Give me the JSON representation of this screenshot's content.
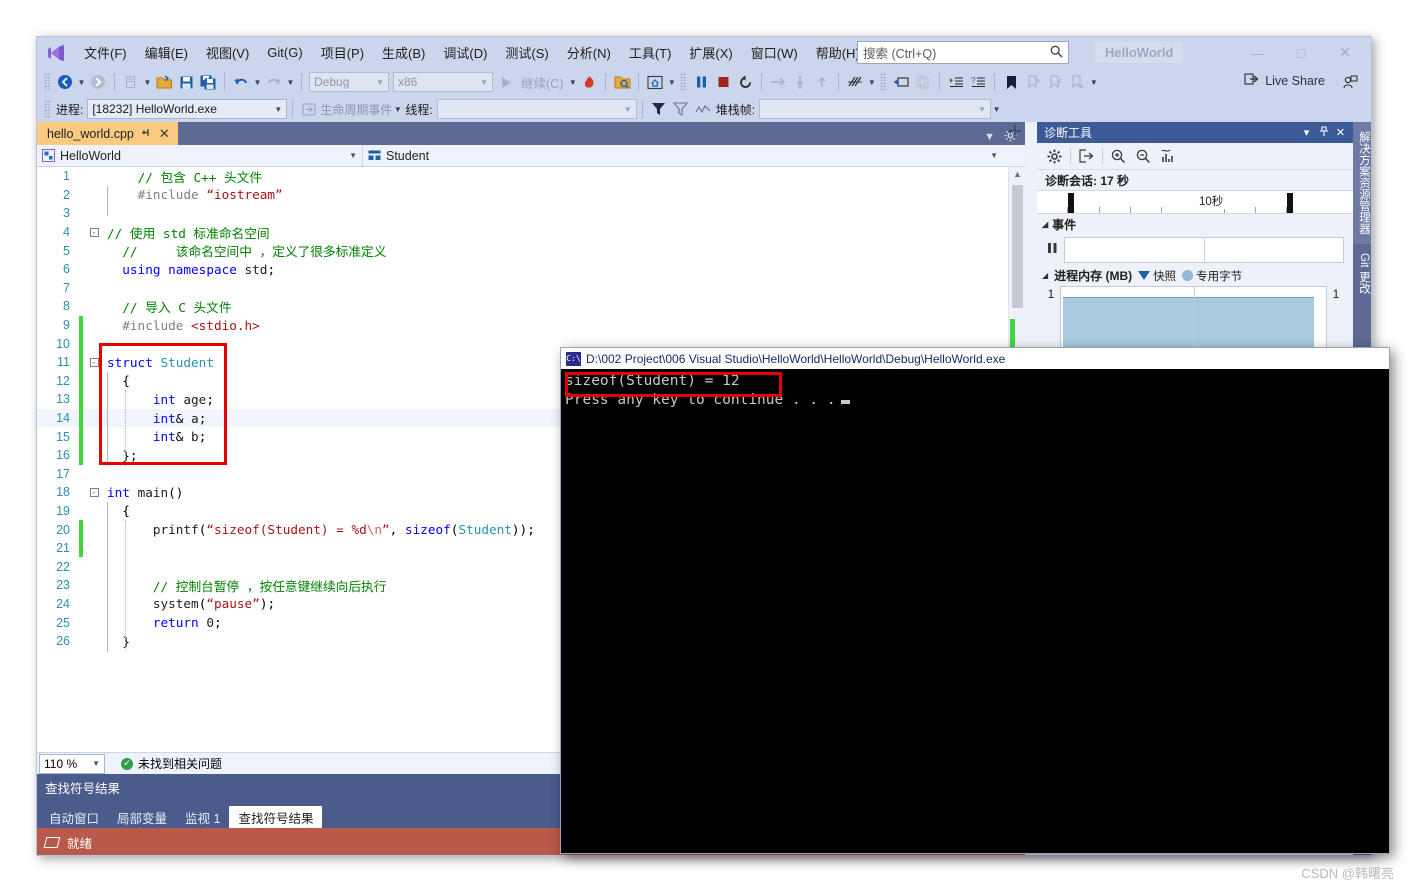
{
  "window": {
    "title": "HelloWorld",
    "minimize": "—",
    "maximize": "□",
    "close": "✕"
  },
  "menubar": {
    "items": [
      {
        "label": "文件(F)"
      },
      {
        "label": "编辑(E)"
      },
      {
        "label": "视图(V)"
      },
      {
        "label": "Git(G)"
      },
      {
        "label": "项目(P)"
      },
      {
        "label": "生成(B)"
      },
      {
        "label": "调试(D)"
      },
      {
        "label": "测试(S)"
      },
      {
        "label": "分析(N)"
      },
      {
        "label": "工具(T)"
      },
      {
        "label": "扩展(X)"
      },
      {
        "label": "窗口(W)"
      },
      {
        "label": "帮助(H)"
      }
    ]
  },
  "search": {
    "placeholder": "搜索 (Ctrl+Q)",
    "icon": "🔍"
  },
  "toolbar": {
    "back_icon": "◉",
    "forward_icon": "○",
    "new_icon": "❐",
    "open_icon": "📂",
    "save_icon": "💾",
    "save_all_icon": "💾",
    "undo_icon": "↶",
    "redo_icon": "↷",
    "config_value": "Debug",
    "platform_value": "x86",
    "continue_label": "继续(C)",
    "hot_reload_icon": "🔥",
    "screenshot_icon": "🗂",
    "home_icon": "⌂",
    "break_all_icon": "❚❚",
    "stop_icon": "■",
    "restart_icon": "↺",
    "step_over_icon": "→",
    "step_into_icon": "↓",
    "step_out_icon": "↑",
    "threads_icon": "⌇",
    "show_next_icon": "⬒",
    "copy_icon": "❐",
    "indent_icon": "≡",
    "comment_icon": "≡",
    "bookmark_icon": "⚑",
    "live_share_label": "Live Share",
    "live_share_icon": "➦",
    "feedback_icon": "⚑"
  },
  "processbar": {
    "process_label": "进程:",
    "process_value": "[18232] HelloWorld.exe",
    "lifecycle_label": "生命周期事件",
    "thread_label": "线程:",
    "thread_value": "",
    "stack_label": "堆栈帧:",
    "filter_icon": "▼",
    "flag_icon": "⚑",
    "chart_icon": "〰"
  },
  "editor": {
    "tab": {
      "name": "hello_world.cpp",
      "pin_icon": "↲",
      "close_icon": "✕"
    },
    "nav_left": "HelloWorld",
    "nav_right": "Student",
    "zoom": "110 %",
    "issue_status": "未找到相关问题",
    "issue_ok_icon": "✓",
    "lines": [
      {
        "n": "1",
        "change": false,
        "fold": "",
        "html": "    <span class=\"cm\">// 包含 C++ 头文件</span>"
      },
      {
        "n": "2",
        "change": false,
        "fold": "",
        "html": "    <span class=\"pp\">#include</span> <span class=\"st\">“iostream”</span>"
      },
      {
        "n": "3",
        "change": false,
        "fold": "",
        "html": ""
      },
      {
        "n": "4",
        "change": false,
        "fold": "-",
        "html": "<span class=\"cm\">// 使用 std 标准命名空间</span>"
      },
      {
        "n": "5",
        "change": false,
        "fold": "",
        "html": "  <span class=\"cm\">//     该命名空间中 ，定义了很多标准定义</span>"
      },
      {
        "n": "6",
        "change": false,
        "fold": "",
        "html": "  <span class=\"kw\">using</span> <span class=\"kw\">namespace</span> <span class=\"fn\">std</span>;"
      },
      {
        "n": "7",
        "change": false,
        "fold": "",
        "html": ""
      },
      {
        "n": "8",
        "change": false,
        "fold": "",
        "html": "  <span class=\"cm\">// 导入 C 头文件</span>"
      },
      {
        "n": "9",
        "change": true,
        "fold": "",
        "html": "  <span class=\"pp\">#include</span> <span class=\"st\">&lt;stdio.h&gt;</span>"
      },
      {
        "n": "10",
        "change": true,
        "fold": "",
        "html": ""
      },
      {
        "n": "11",
        "change": true,
        "fold": "-",
        "html": "<span class=\"kw\">struct</span> <span class=\"ty\">Student</span>"
      },
      {
        "n": "12",
        "change": true,
        "fold": "",
        "html": "  {"
      },
      {
        "n": "13",
        "change": true,
        "fold": "",
        "html": "      <span class=\"kw\">int</span> <span class=\"fn\">age</span>;"
      },
      {
        "n": "14",
        "change": true,
        "fold": "",
        "html": "      <span class=\"kw\">int</span>&amp; <span class=\"fn\">a</span>;"
      },
      {
        "n": "15",
        "change": true,
        "fold": "",
        "html": "      <span class=\"kw\">int</span>&amp; <span class=\"fn\">b</span>;"
      },
      {
        "n": "16",
        "change": true,
        "fold": "",
        "html": "  };"
      },
      {
        "n": "17",
        "change": false,
        "fold": "",
        "html": ""
      },
      {
        "n": "18",
        "change": false,
        "fold": "-",
        "html": "<span class=\"kw\">int</span> <span class=\"fn\">main</span>()"
      },
      {
        "n": "19",
        "change": false,
        "fold": "",
        "html": "  {"
      },
      {
        "n": "20",
        "change": true,
        "fold": "",
        "html": "      <span class=\"fn\">printf</span>(<span class=\"st\">“sizeof(Student) = %d</span><span class=\"esc\">\\n</span><span class=\"st\">”</span>, <span class=\"kw\">sizeof</span>(<span class=\"ty\">Student</span>));"
      },
      {
        "n": "21",
        "change": true,
        "fold": "",
        "html": ""
      },
      {
        "n": "22",
        "change": false,
        "fold": "",
        "html": ""
      },
      {
        "n": "23",
        "change": false,
        "fold": "",
        "html": "      <span class=\"cm\">// 控制台暂停 ，按任意键继续向后执行</span>"
      },
      {
        "n": "24",
        "change": false,
        "fold": "",
        "html": "      <span class=\"fn\">system</span>(<span class=\"st\">“pause”</span>);"
      },
      {
        "n": "25",
        "change": false,
        "fold": "",
        "html": "      <span class=\"kw\">return</span> <span class=\"num\">0</span>;"
      },
      {
        "n": "26",
        "change": false,
        "fold": "",
        "html": "  }"
      }
    ]
  },
  "bottom_panel": {
    "title": "查找符号结果",
    "tabs": [
      {
        "label": "自动窗口",
        "active": false
      },
      {
        "label": "局部变量",
        "active": false
      },
      {
        "label": "监视 1",
        "active": false
      },
      {
        "label": "查找符号结果",
        "active": true
      }
    ]
  },
  "statusbar": {
    "text": "就绪"
  },
  "diagnostics": {
    "title": "诊断工具",
    "dropdown_icon": "▾",
    "pin_icon": "↲",
    "close_icon": "✕",
    "tools": {
      "settings_icon": "⚙",
      "export_icon": "➦",
      "zoom_in_icon": "⊕",
      "zoom_out_icon": "⊖",
      "chart_icon": "📊"
    },
    "session_label": "诊断会话: 17 秒",
    "ruler_label": "10秒",
    "events_section": "事件",
    "events_pause_icon": "❚❚",
    "memory_section": "进程内存 (MB)",
    "legend_snapshot": "快照",
    "legend_private": "专用字节",
    "axis_left": "1",
    "axis_right": "1"
  },
  "vdock": {
    "tabs": [
      {
        "label": "解决方案资源管理器"
      },
      {
        "label": "Git 更改"
      }
    ]
  },
  "console": {
    "title": "D:\\002 Project\\006 Visual Studio\\HelloWorld\\HelloWorld\\Debug\\HelloWorld.exe",
    "icon": "C:\\",
    "lines": [
      "sizeof(Student) = 12",
      "Press any key to continue . . ."
    ]
  },
  "watermark": "CSDN @韩曙亮",
  "colors": {
    "menubar": "#cbd6ec",
    "accent_tab": "#f8cb80",
    "statusbar": "#b9594a",
    "panel_header": "#3c5a96",
    "annotation_red": "#e60000"
  }
}
